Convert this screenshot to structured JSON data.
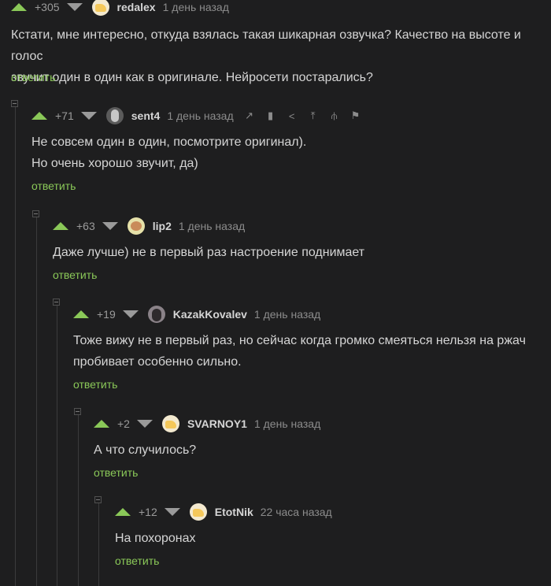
{
  "colors": {
    "accent": "#8ac858",
    "background": "#1e1e1f",
    "text": "#d5d5d5",
    "muted": "#8c8c8c"
  },
  "comments": [
    {
      "rating": "+305",
      "user": "redalex",
      "time": "1 день назад",
      "avatar": "cheese-avatar",
      "lines": [
        "Кстати, мне интересно, откуда взялась такая шикарная озвучка? Качество на высоте и голос",
        "звучит один в один как в оригинале. Нейросети постарались?"
      ],
      "reply": "ответить"
    },
    {
      "rating": "+71",
      "user": "sent4",
      "time": "1 день назад",
      "avatar": "sent4-avatar",
      "lines": [
        "Не совсем один в один, посмотрите оригинал).",
        "Но очень хорошо звучит, да)"
      ],
      "reply": "ответить",
      "tools": [
        "link-icon",
        "bookmark-icon",
        "share-icon",
        "go-to-parent-icon",
        "branch-icon",
        "report-flag-icon"
      ]
    },
    {
      "rating": "+63",
      "user": "lip2",
      "time": "1 день назад",
      "avatar": "lip2-avatar",
      "lines": [
        "Даже лучше) не в первый раз настроение поднимает"
      ],
      "reply": "ответить"
    },
    {
      "rating": "+19",
      "user": "KazakKovalev",
      "time": "1 день назад",
      "avatar": "kazak-avatar",
      "lines": [
        "Тоже вижу не в первый раз, но сейчас когда громко смеяться нельзя на ржач",
        "пробивает особенно сильно."
      ],
      "reply": "ответить"
    },
    {
      "rating": "+2",
      "user": "SVARNOY1",
      "time": "1 день назад",
      "avatar": "cheese-avatar",
      "lines": [
        "А что случилось?"
      ],
      "reply": "ответить"
    },
    {
      "rating": "+12",
      "user": "EtotNik",
      "time": "22 часа назад",
      "avatar": "cheese-avatar",
      "lines": [
        "На похоронах"
      ],
      "reply": "ответить"
    }
  ]
}
